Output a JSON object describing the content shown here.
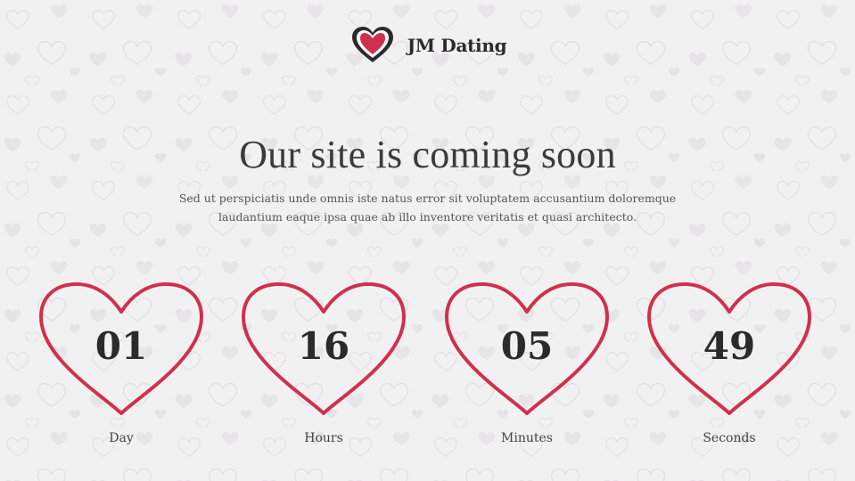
{
  "brand": {
    "name": "JM Dating",
    "logo_icon": "heart-logo-icon",
    "accent": "#d0304f"
  },
  "headline": "Our site is coming soon",
  "subtext": {
    "line1": "Sed ut perspiciatis unde omnis iste natus error sit voluptatem accusantium doloremque",
    "line2": "laudantium eaque ipsa quae ab illo inventore veritatis et quasi architecto."
  },
  "countdown": [
    {
      "value": "01",
      "label": "Day"
    },
    {
      "value": "16",
      "label": "Hours"
    },
    {
      "value": "05",
      "label": "Minutes"
    },
    {
      "value": "49",
      "label": "Seconds"
    }
  ],
  "colors": {
    "background": "#f2f1f2",
    "heart_stroke": "#d0304f",
    "text_dark": "#2b2b2b"
  }
}
